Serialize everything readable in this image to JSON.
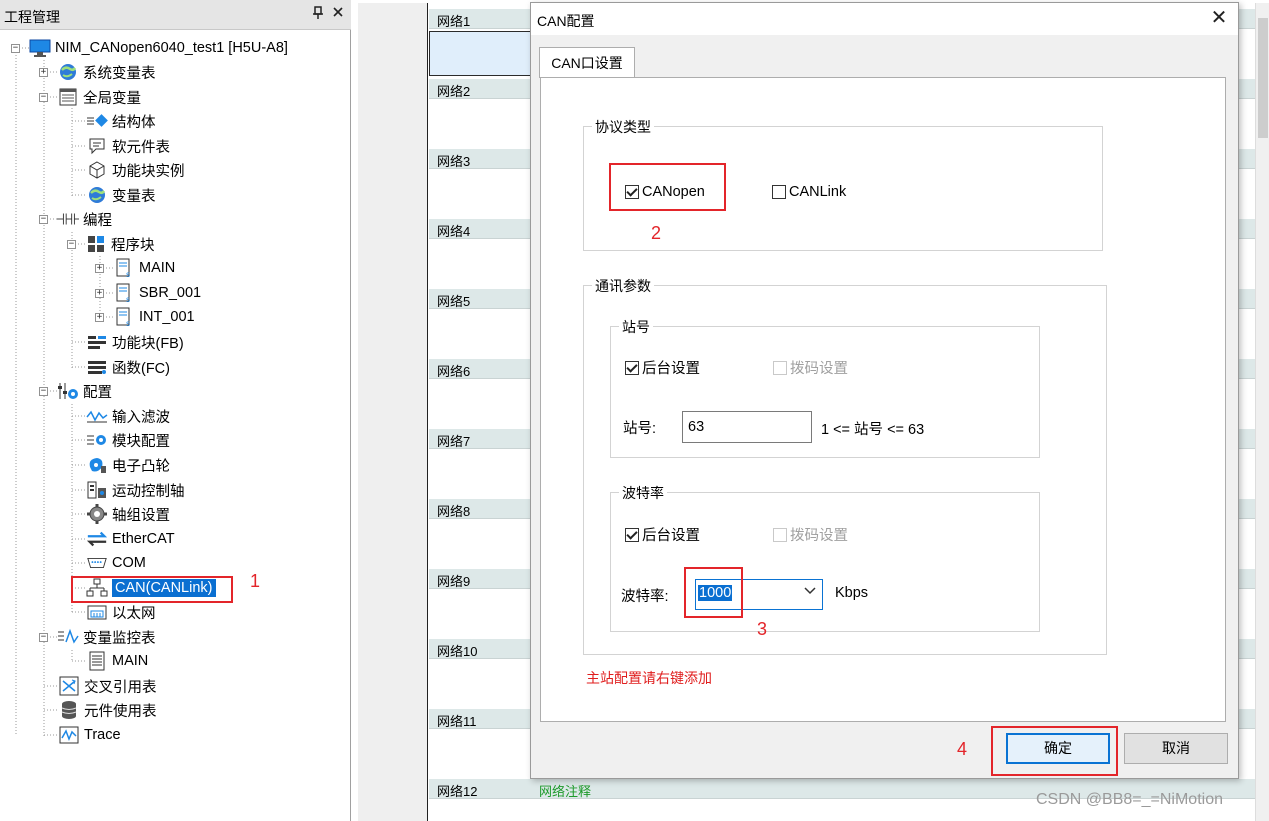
{
  "project_panel": {
    "title": "工程管理",
    "pin_glyph": "ꟷ",
    "close_glyph": "×",
    "tree": {
      "root": "NIM_CANopen6040_test1 [H5U-A8]",
      "system_vars": "系统变量表",
      "global_vars": "全局变量",
      "struct": "结构体",
      "soft_elements": "软元件表",
      "fb_instance": "功能块实例",
      "var_table": "变量表",
      "programming": "编程",
      "program_blocks": "程序块",
      "main": "MAIN",
      "sbr": "SBR_001",
      "int": "INT_001",
      "fb": "功能块(FB)",
      "fc": "函数(FC)",
      "config": "配置",
      "input_filter": "输入滤波",
      "module_config": "模块配置",
      "cam": "电子凸轮",
      "motion_axis": "运动控制轴",
      "axis_group": "轴组设置",
      "ethercat": "EtherCAT",
      "com": "COM",
      "can": "CAN(CANLink)",
      "ethernet": "以太网",
      "monitor_table": "变量监控表",
      "monitor_main": "MAIN",
      "cross_ref": "交叉引用表",
      "element_usage": "元件使用表",
      "trace": "Trace"
    }
  },
  "editor": {
    "networks": [
      "网络1",
      "网络2",
      "网络3",
      "网络4",
      "网络5",
      "网络6",
      "网络7",
      "网络8",
      "网络9",
      "网络10",
      "网络11",
      "网络12"
    ],
    "network12_comment": "网络注释"
  },
  "dialog": {
    "title": "CAN配置",
    "close_glyph": "✕",
    "tab_label": "CAN口设置",
    "protocol": {
      "group_title": "协议类型",
      "canopen_label": "CANopen",
      "canopen_checked": true,
      "canlink_label": "CANLink",
      "canlink_checked": false
    },
    "comm": {
      "group_title": "通讯参数",
      "station": {
        "group_title": "站号",
        "backend_label": "后台设置",
        "backend_checked": true,
        "dip_label": "拨码设置",
        "field_label": "站号:",
        "value": "63",
        "range_text": "1 <= 站号 <= 63"
      },
      "baud": {
        "group_title": "波特率",
        "backend_label": "后台设置",
        "backend_checked": true,
        "dip_label": "拨码设置",
        "field_label": "波特率:",
        "value": "1000",
        "unit": "Kbps"
      }
    },
    "hint": "主站配置请右键添加",
    "ok_label": "确定",
    "cancel_label": "取消"
  },
  "annotations": {
    "n1": "1",
    "n2": "2",
    "n3": "3",
    "n4": "4",
    "color": "#e3252a"
  },
  "watermark": "CSDN @BB8=_=NiMotion"
}
